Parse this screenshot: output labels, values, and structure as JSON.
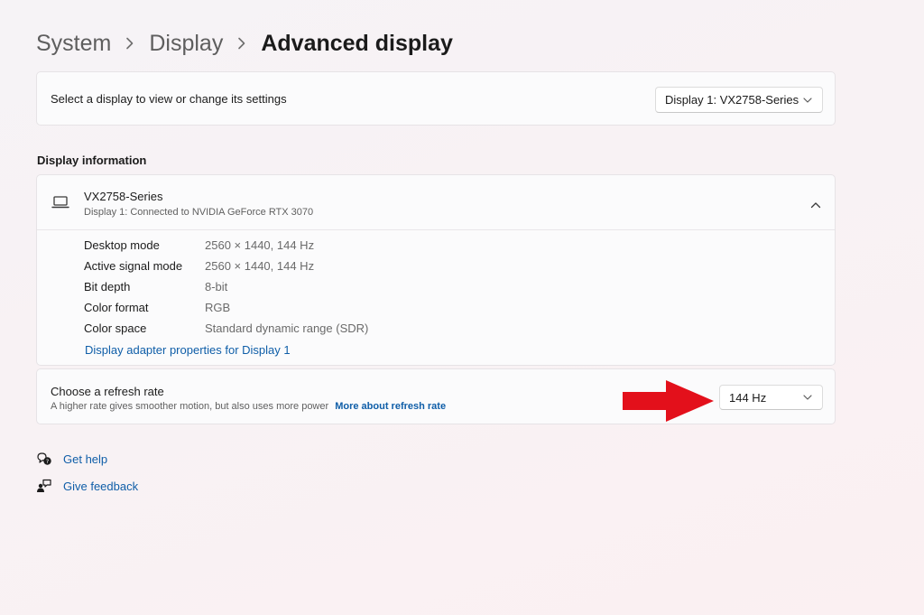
{
  "breadcrumb": {
    "items": [
      "System",
      "Display"
    ],
    "current": "Advanced display"
  },
  "display_select": {
    "label": "Select a display to view or change its settings",
    "selected": "Display 1: VX2758-Series"
  },
  "display_info": {
    "heading": "Display information",
    "monitor_name": "VX2758-Series",
    "monitor_sub": "Display 1: Connected to NVIDIA GeForce RTX 3070",
    "expanded": true,
    "rows": [
      {
        "label": "Desktop mode",
        "value": "2560 × 1440, 144 Hz"
      },
      {
        "label": "Active signal mode",
        "value": "2560 × 1440, 144 Hz"
      },
      {
        "label": "Bit depth",
        "value": "8-bit"
      },
      {
        "label": "Color format",
        "value": "RGB"
      },
      {
        "label": "Color space",
        "value": "Standard dynamic range (SDR)"
      }
    ],
    "adapter_link": "Display adapter properties for Display 1"
  },
  "refresh_rate": {
    "title": "Choose a refresh rate",
    "description": "A higher rate gives smoother motion, but also uses more power",
    "link": "More about refresh rate",
    "selected": "144 Hz"
  },
  "help_links": {
    "get_help": "Get help",
    "give_feedback": "Give feedback"
  },
  "icons": {
    "breadcrumb_separator": "chevron-right-icon",
    "dropdown": "chevron-down-icon",
    "monitor": "laptop-icon",
    "collapse": "chevron-up-icon",
    "annotation": "red-arrow-icon",
    "get_help": "help-chat-icon",
    "give_feedback": "feedback-icon"
  },
  "colors": {
    "accent_link": "#0f5ea8",
    "annotation_arrow": "#e3101b",
    "card_background": "#fbfbfc"
  }
}
